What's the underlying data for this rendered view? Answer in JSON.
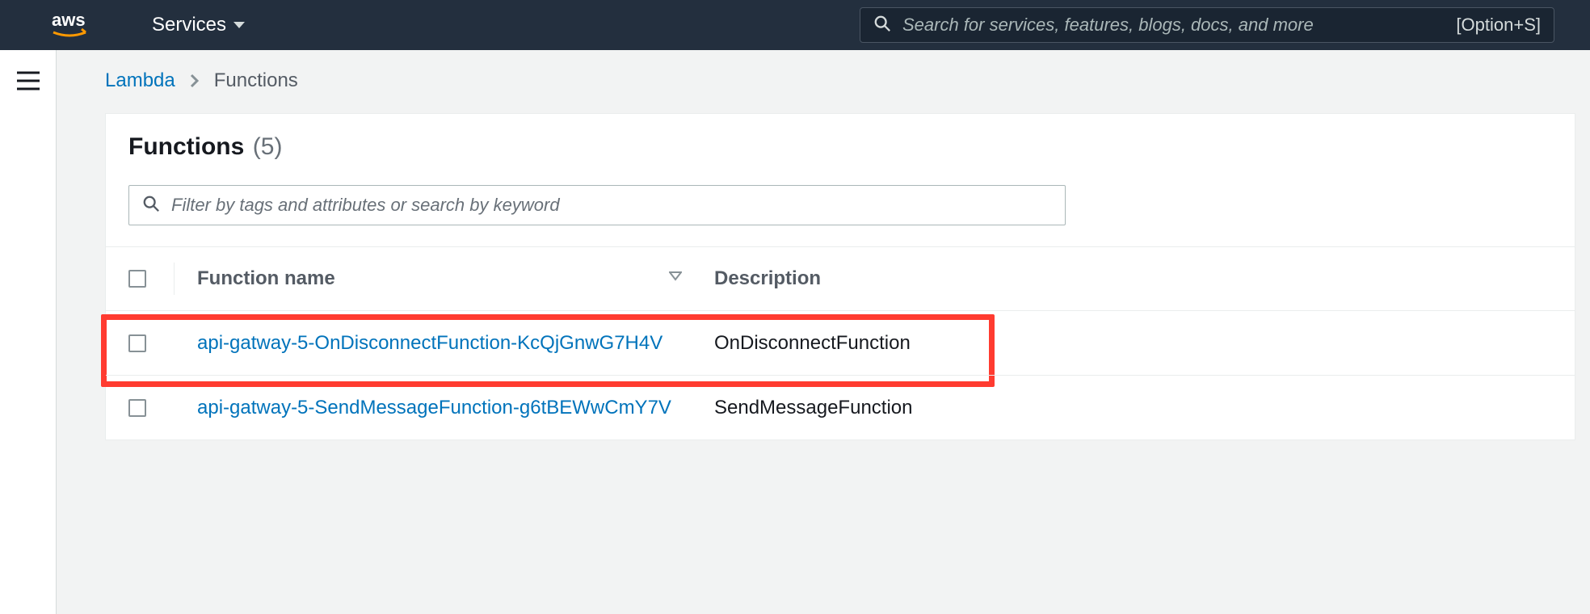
{
  "topnav": {
    "services_label": "Services",
    "search_placeholder": "Search for services, features, blogs, docs, and more",
    "shortcut": "[Option+S]"
  },
  "breadcrumb": {
    "root": "Lambda",
    "current": "Functions"
  },
  "panel": {
    "title": "Functions",
    "count": "(5)",
    "filter_placeholder": "Filter by tags and attributes or search by keyword"
  },
  "columns": {
    "name": "Function name",
    "description": "Description"
  },
  "rows": [
    {
      "name": "api-gatway-5-OnDisconnectFunction-KcQjGnwG7H4V",
      "description": "OnDisconnectFunction",
      "highlighted": true
    },
    {
      "name": "api-gatway-5-SendMessageFunction-g6tBEWwCmY7V",
      "description": "SendMessageFunction",
      "highlighted": false
    }
  ]
}
